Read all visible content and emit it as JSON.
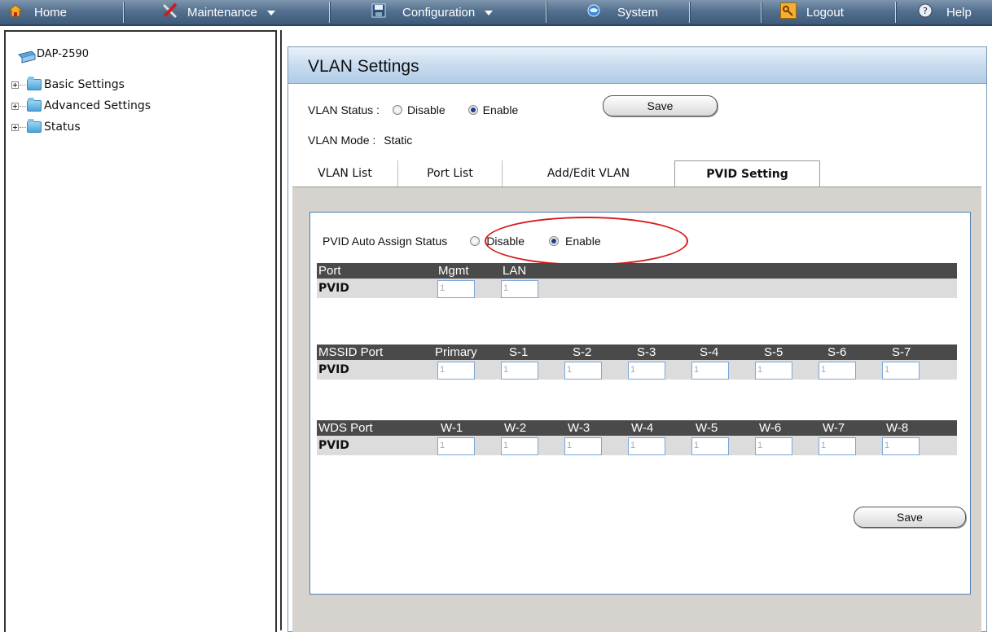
{
  "topbar": {
    "items": [
      {
        "label": "Home",
        "icon": "home-icon",
        "dropdown": false
      },
      {
        "label": "Maintenance",
        "icon": "tools-icon",
        "dropdown": true
      },
      {
        "label": "Configuration",
        "icon": "floppy-disk-icon",
        "dropdown": true
      },
      {
        "label": "System",
        "icon": "globe-icon",
        "dropdown": false
      },
      {
        "label": "Logout",
        "icon": "key-icon",
        "dropdown": false
      },
      {
        "label": "Help",
        "icon": "help-icon",
        "dropdown": false
      }
    ]
  },
  "tree": {
    "root": "DAP-2590",
    "nodes": [
      "Basic Settings",
      "Advanced Settings",
      "Status"
    ]
  },
  "page": {
    "title": "VLAN Settings",
    "vlan_status_label": "VLAN Status :",
    "disable_label": "Disable",
    "enable_label": "Enable",
    "vlan_status_selected": "Enable",
    "save_label": "Save",
    "vlan_mode_label": "VLAN Mode :",
    "vlan_mode_value": "Static"
  },
  "tabs": [
    {
      "label": "VLAN List",
      "active": false
    },
    {
      "label": "Port List",
      "active": false
    },
    {
      "label": "Add/Edit VLAN",
      "active": false
    },
    {
      "label": "PVID Setting",
      "active": true
    }
  ],
  "pvid": {
    "auto_assign_label": "PVID Auto Assign Status",
    "disable_label": "Disable",
    "enable_label": "Enable",
    "selected": "Enable",
    "pvid_label": "PVID",
    "port_table": {
      "header": "Port",
      "columns": [
        "Mgmt",
        "LAN"
      ],
      "values": [
        "1",
        "1"
      ]
    },
    "mssid_table": {
      "header": "MSSID Port",
      "columns": [
        "Primary",
        "S-1",
        "S-2",
        "S-3",
        "S-4",
        "S-5",
        "S-6",
        "S-7"
      ],
      "values": [
        "1",
        "1",
        "1",
        "1",
        "1",
        "1",
        "1",
        "1"
      ]
    },
    "wds_table": {
      "header": "WDS Port",
      "columns": [
        "W-1",
        "W-2",
        "W-3",
        "W-4",
        "W-5",
        "W-6",
        "W-7",
        "W-8"
      ],
      "values": [
        "1",
        "1",
        "1",
        "1",
        "1",
        "1",
        "1",
        "1"
      ]
    },
    "save_label": "Save"
  },
  "colors": {
    "accent_ellipse": "#d91a1a",
    "topbar": "#53708f",
    "table_header": "#4a4a4a"
  }
}
